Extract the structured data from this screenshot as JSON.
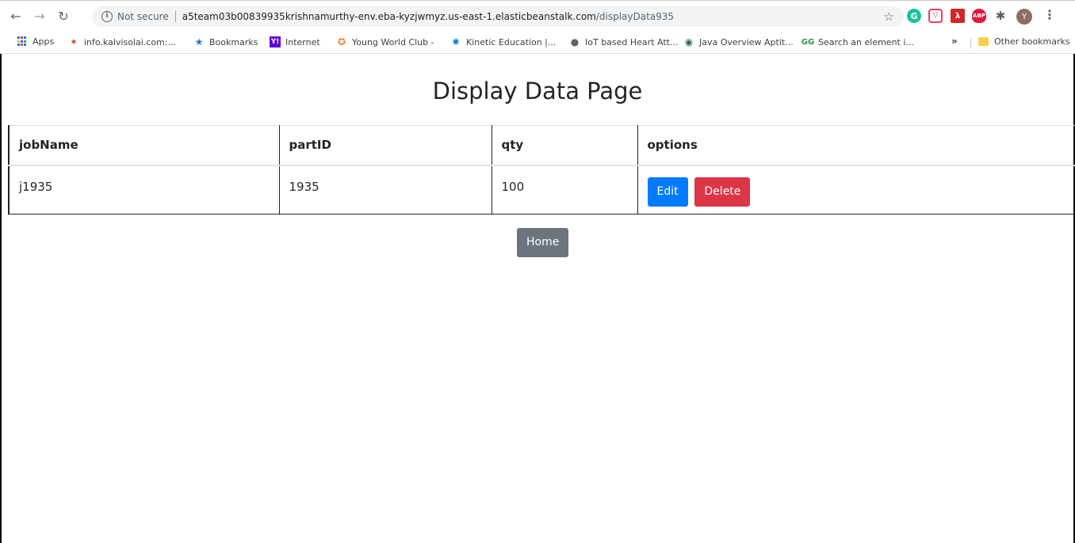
{
  "browser": {
    "security_label": "Not secure",
    "url_host": "a5team03b00839935krishnamurthy-env.eba-kyzjwmyz.us-east-1.elasticbeanstalk.com",
    "url_path": "/displayData935",
    "avatar_letter": "Y",
    "bookmarks": [
      {
        "label": "Apps",
        "icon": "apps-grid-icon"
      },
      {
        "label": "info.kalvisolai.com:...",
        "icon": "kalvisolai-favicon"
      },
      {
        "label": "Bookmarks",
        "icon": "star-bookmark-icon"
      },
      {
        "label": "Internet",
        "icon": "yahoo-favicon"
      },
      {
        "label": "Young World Club -",
        "icon": "young-world-favicon"
      },
      {
        "label": "Kinetic Education |...",
        "icon": "kinetic-favicon"
      },
      {
        "label": "IoT based Heart Att...",
        "icon": "globe-icon"
      },
      {
        "label": "Java Overview Aptit...",
        "icon": "java-favicon"
      },
      {
        "label": "Search an element i...",
        "icon": "gfg-favicon"
      }
    ],
    "overflow_label": "»",
    "other_bookmarks": "Other bookmarks"
  },
  "page": {
    "title": "Display Data Page",
    "table": {
      "headers": [
        "jobName",
        "partID",
        "qty",
        "options"
      ],
      "rows": [
        {
          "jobName": "j1935",
          "partID": "1935",
          "qty": "100"
        }
      ]
    },
    "edit_label": "Edit",
    "delete_label": "Delete",
    "home_label": "Home"
  },
  "colors": {
    "edit": "#007bff",
    "delete": "#dc3545",
    "home": "#6c757d"
  }
}
